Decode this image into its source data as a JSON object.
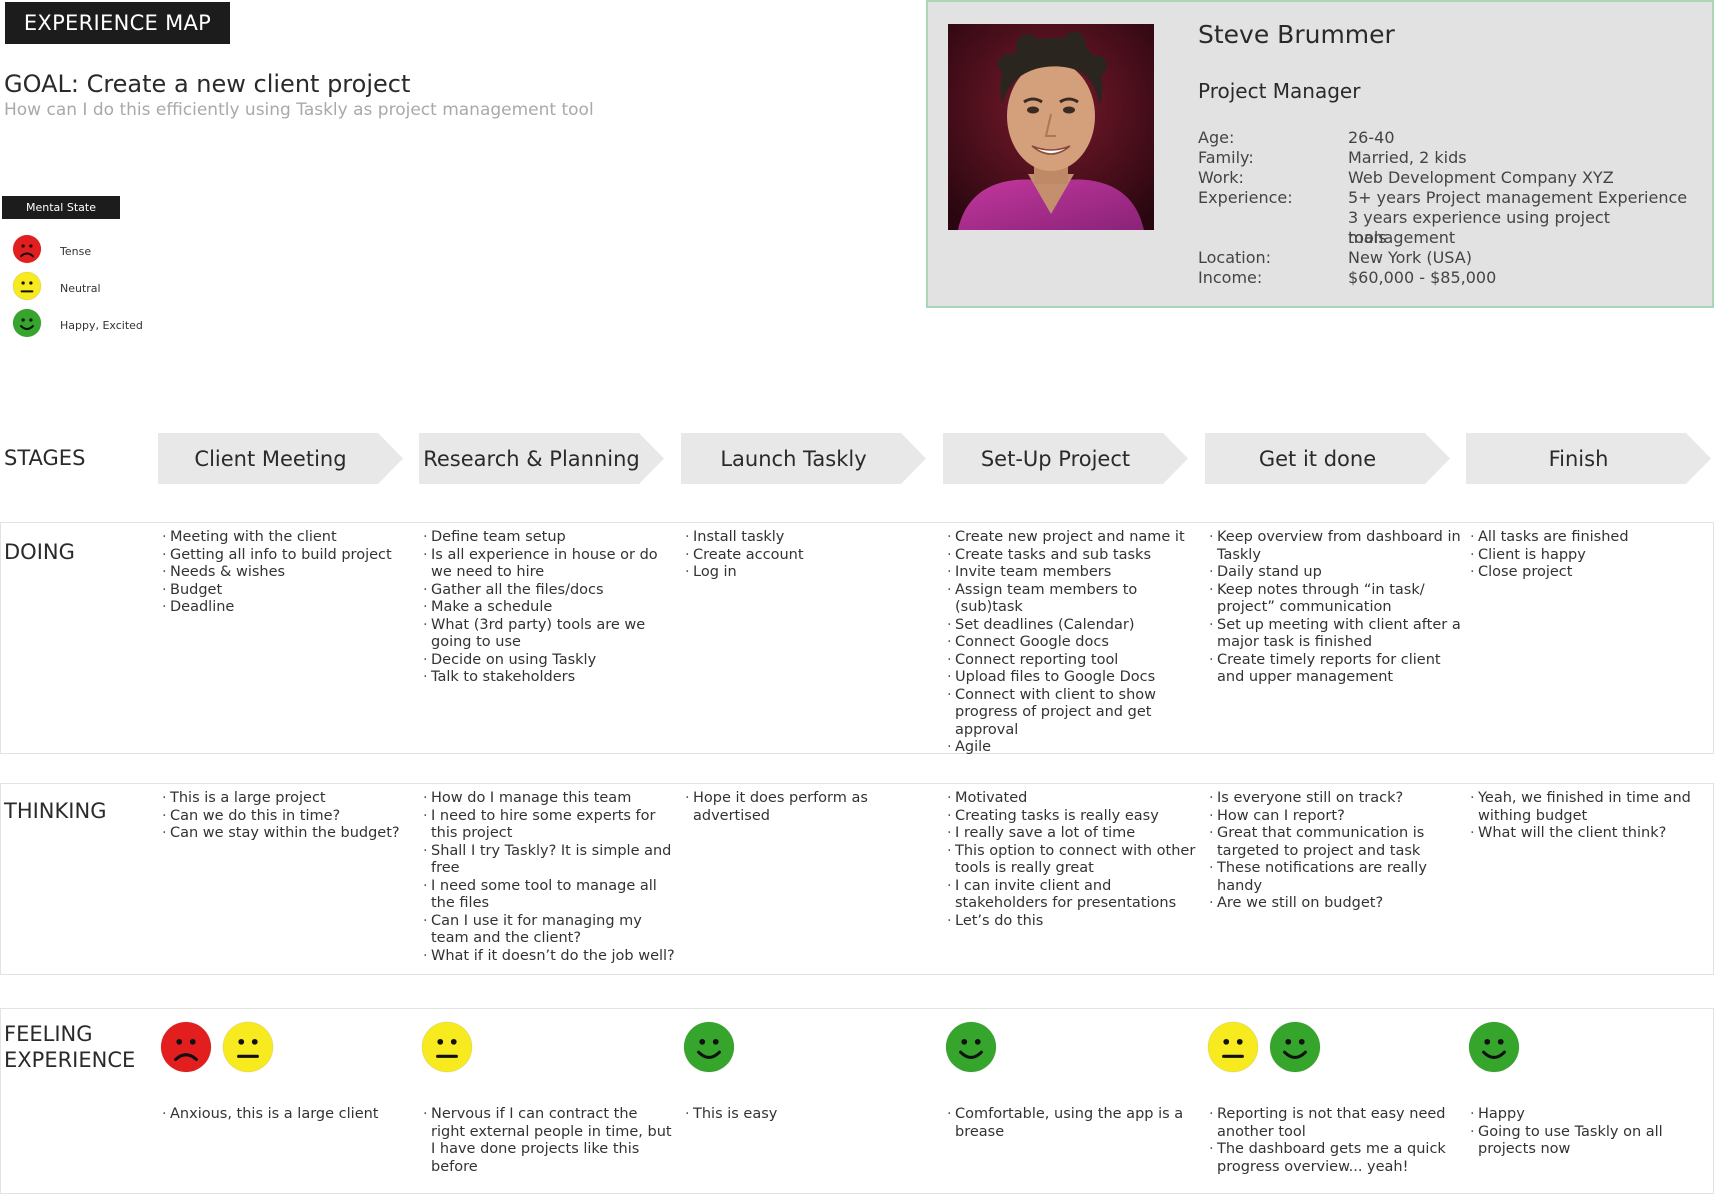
{
  "header": {
    "badge": "EXPERIENCE MAP",
    "goal": "GOAL: Create a new client project",
    "goal_sub": "How can I do this efficiently using Taskly as project management tool"
  },
  "legend": {
    "title": "Mental State",
    "items": [
      {
        "label": "Tense",
        "mood": "sad",
        "color": "#e31e1e"
      },
      {
        "label": "Neutral",
        "mood": "neutral",
        "color": "#f7ea1e"
      },
      {
        "label": "Happy, Excited",
        "mood": "happy",
        "color": "#35a52c"
      }
    ]
  },
  "persona": {
    "name": "Steve Brummer",
    "role": "Project Manager",
    "photo_icon": "person-portrait",
    "info": [
      {
        "label": "Age:",
        "value": "26-40"
      },
      {
        "label": "Family:",
        "value": "Married, 2 kids"
      },
      {
        "label": "Work:",
        "value": "Web Development Company XYZ"
      },
      {
        "label": "Experience:",
        "value": "5+ years Project management Experience"
      },
      {
        "label": "",
        "value": "3 years experience using project management"
      },
      {
        "label": "",
        "value": "tools"
      },
      {
        "label": "Location:",
        "value": "New York (USA)"
      },
      {
        "label": "Income:",
        "value": "$60,000 - $85,000"
      }
    ]
  },
  "rows": {
    "stages": "STAGES",
    "doing": "DOING",
    "thinking": "THINKING",
    "feeling_line1": "FEELING",
    "feeling_line2": "EXPERIENCE"
  },
  "colors": {
    "sad": "#e31e1e",
    "neutral": "#f7ea1e",
    "happy": "#35a52c",
    "stage_fill": "#e8e8e8"
  },
  "stages": [
    {
      "name": "Client Meeting",
      "doing": [
        "Meeting with the client",
        "Getting all info to build project",
        "Needs & wishes",
        "Budget",
        "Deadline"
      ],
      "thinking": [
        "This is a large project",
        "Can we do this in time?",
        "Can we stay within the budget?"
      ],
      "feeling_faces": [
        "sad",
        "neutral"
      ],
      "feeling_text": [
        "Anxious, this is a large client"
      ]
    },
    {
      "name": "Research & Planning",
      "doing": [
        "Define team setup",
        "Is all experience in house or do we need to hire",
        "Gather all the files/docs",
        "Make a schedule",
        "What (3rd party) tools are we going to use",
        "Decide on using Taskly",
        "Talk to stakeholders"
      ],
      "thinking": [
        "How do I manage this team",
        "I need to hire some experts for this project",
        "Shall I try Taskly? It is simple and free",
        "I need some tool to manage all the files",
        "Can I use it for managing my team and the client?",
        "What if it doesn’t do the job well?"
      ],
      "feeling_faces": [
        "neutral"
      ],
      "feeling_text": [
        "Nervous if I can contract the right external people in time, but I have done projects like this before"
      ]
    },
    {
      "name": "Launch Taskly",
      "doing": [
        "Install taskly",
        "Create account",
        "Log in"
      ],
      "thinking": [
        "Hope it does perform as advertised"
      ],
      "feeling_faces": [
        "happy"
      ],
      "feeling_text": [
        "This is easy"
      ]
    },
    {
      "name": "Set-Up Project",
      "doing": [
        "Create new project and name it",
        "Create tasks and sub tasks",
        "Invite team members",
        "Assign team members to (sub)task",
        "Set deadlines (Calendar)",
        "Connect Google docs",
        "Connect reporting tool",
        "Upload files to Google Docs",
        "Connect with client to show progress of project and get approval",
        "Agile"
      ],
      "thinking": [
        "Motivated",
        "Creating tasks is really easy",
        "I really save a lot of time",
        "This option to connect with other tools is really great",
        "I can invite client and stakeholders for presentations",
        "Let’s do this"
      ],
      "feeling_faces": [
        "happy"
      ],
      "feeling_text": [
        "Comfortable, using the app is a brease"
      ]
    },
    {
      "name": "Get it done",
      "doing": [
        "Keep overview from dashboard in Taskly",
        "Daily stand up",
        "Keep notes through “in task/ project” communication",
        "Set up meeting with client after a major task is finished",
        "Create timely reports for client and upper management"
      ],
      "thinking": [
        "Is everyone still on track?",
        "How can I report?",
        "Great that communication is targeted to project and task",
        "These notifications are really handy",
        "Are we still on budget?"
      ],
      "feeling_faces": [
        "neutral",
        "happy"
      ],
      "feeling_text": [
        "Reporting is not that easy need another tool",
        "The dashboard gets me a quick progress overview... yeah!"
      ]
    },
    {
      "name": "Finish",
      "doing": [
        "All tasks are finished",
        "Client is happy",
        "Close project"
      ],
      "thinking": [
        "Yeah, we finished in time and withing budget",
        "What will the client think?"
      ],
      "feeling_faces": [
        "happy"
      ],
      "feeling_text": [
        "Happy",
        "Going to use Taskly on all projects now"
      ]
    }
  ]
}
